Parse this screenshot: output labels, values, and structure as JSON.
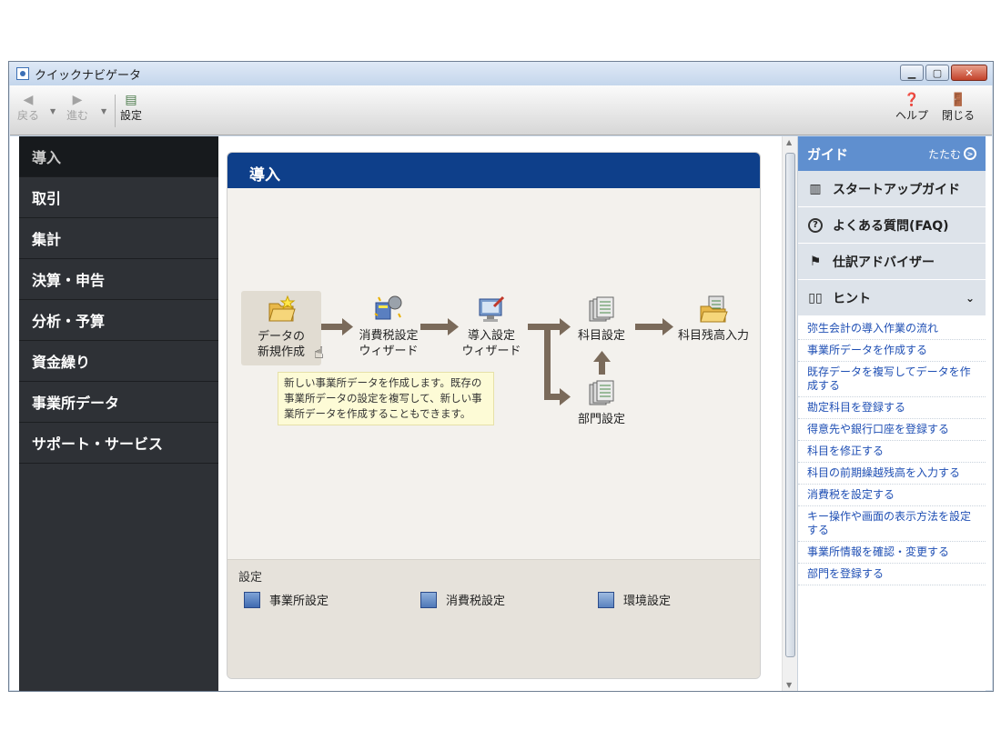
{
  "window": {
    "title": "クイックナビゲータ"
  },
  "toolbar": {
    "back_label": "戻る",
    "forward_label": "進む",
    "settings_label": "設定",
    "help_label": "ヘルプ",
    "close_label": "閉じる"
  },
  "nav": {
    "items": [
      {
        "label": "導入"
      },
      {
        "label": "取引"
      },
      {
        "label": "集計"
      },
      {
        "label": "決算・申告"
      },
      {
        "label": "分析・予算"
      },
      {
        "label": "資金繰り"
      },
      {
        "label": "事業所データ"
      },
      {
        "label": "サポート・サービス"
      }
    ]
  },
  "main": {
    "panel_title": "導入",
    "flow": {
      "new_data_line1": "データの",
      "new_data_line2": "新規作成",
      "tax_wizard_line1": "消費税設定",
      "tax_wizard_line2": "ウィザード",
      "setup_wizard_line1": "導入設定",
      "setup_wizard_line2": "ウィザード",
      "account_setting": "科目設定",
      "account_balance": "科目残高入力",
      "department_setting": "部門設定"
    },
    "tooltip": "新しい事業所データを作成します。既存の事業所データの設定を複写して、新しい事業所データを作成することもできます。",
    "settings": {
      "label": "設定",
      "office": "事業所設定",
      "tax": "消費税設定",
      "env": "環境設定"
    }
  },
  "guide": {
    "title": "ガイド",
    "collapse_label": "たたむ",
    "startup": "スタートアップガイド",
    "faq": "よくある質問(FAQ)",
    "advisor": "仕訳アドバイザー",
    "hint": "ヒント",
    "links": [
      "弥生会計の導入作業の流れ",
      "事業所データを作成する",
      "既存データを複写してデータを作成する",
      "勘定科目を登録する",
      "得意先や銀行口座を登録する",
      "科目を修正する",
      "科目の前期繰越残高を入力する",
      "消費税を設定する",
      "キー操作や画面の表示方法を設定する",
      "事業所情報を確認・変更する",
      "部門を登録する"
    ]
  },
  "colors": {
    "nav_bg": "#2e3136",
    "panel_header": "#0e3f8a",
    "guide_header": "#5f8fcf",
    "link": "#1f4fb4",
    "flow_arrow": "#7a6a5a"
  },
  "icons": [
    "back-arrow-icon",
    "forward-arrow-icon",
    "settings-icon",
    "help-icon",
    "close-door-icon",
    "map-icon",
    "question-icon",
    "flag-icon",
    "book-icon"
  ]
}
